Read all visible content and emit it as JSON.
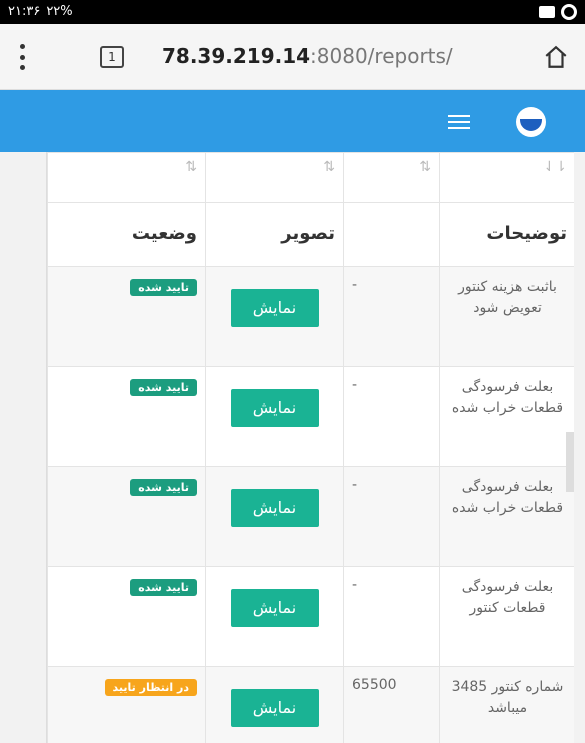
{
  "status_bar": {
    "time_text": "۲۱:۳۶",
    "battery_text": "۲۲%"
  },
  "browser": {
    "url_host": "78.39.219.14",
    "url_rest": ":8080/reports/",
    "tab_count": "1"
  },
  "table": {
    "headers": {
      "description": "توضیحات",
      "number": "",
      "image": "تصویر",
      "status": "وضعیت"
    },
    "sort_glyph_active": "⇂⇃",
    "sort_glyph": "⇅",
    "rows": [
      {
        "description": "باثبت هزینه کنتور تعویض شود",
        "number": "-",
        "image_button": "نمایش",
        "status": "تایید شده",
        "status_color": "#1c9d7f"
      },
      {
        "description": "بعلت فرسودگی قطعات خراب شده",
        "number": "-",
        "image_button": "نمایش",
        "status": "تایید شده",
        "status_color": "#1c9d7f"
      },
      {
        "description": "بعلت فرسودگی قطعات خراب شده",
        "number": "-",
        "image_button": "نمایش",
        "status": "تایید شده",
        "status_color": "#1c9d7f"
      },
      {
        "description": "بعلت فرسودگی قطعات کنتور",
        "number": "-",
        "image_button": "نمایش",
        "status": "تایید شده",
        "status_color": "#1c9d7f"
      },
      {
        "description": "شماره کنتور 3485 میباشد",
        "number": "65500",
        "image_button": "نمایش",
        "status": "در انتظار تایید",
        "status_color": "#f7a51c"
      }
    ]
  }
}
